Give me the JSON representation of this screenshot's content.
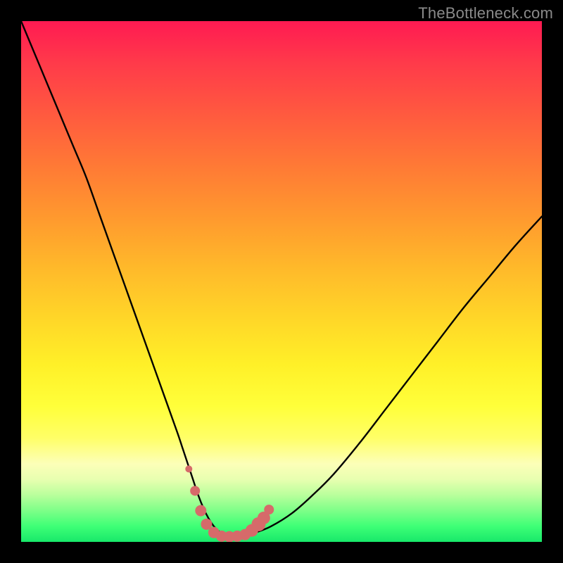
{
  "watermark": {
    "text": "TheBottleneck.com"
  },
  "chart_data": {
    "type": "line",
    "title": "",
    "xlabel": "",
    "ylabel": "",
    "xlim": [
      0,
      100
    ],
    "ylim": [
      0,
      100
    ],
    "series": [
      {
        "name": "bottleneck-curve",
        "x": [
          0,
          2.5,
          5,
          7.5,
          10,
          12.5,
          15,
          17.5,
          20,
          22.5,
          25,
          27.5,
          30,
          31,
          32,
          33,
          34,
          35,
          36,
          37,
          38,
          39,
          40,
          41,
          43,
          45,
          48,
          52,
          56,
          60,
          65,
          70,
          75,
          80,
          85,
          90,
          95,
          100
        ],
        "y": [
          100,
          94,
          88,
          82,
          76,
          70,
          63,
          56,
          49,
          42,
          35,
          28,
          21,
          18,
          15,
          12,
          9,
          6.5,
          4.5,
          3,
          2,
          1.3,
          1,
          1,
          1.2,
          1.8,
          3,
          5.5,
          9,
          13,
          19,
          25.5,
          32,
          38.5,
          45,
          51,
          57,
          62.5
        ]
      }
    ],
    "beads": {
      "name": "marker-beads",
      "color": "#d66a6a",
      "points": [
        {
          "x": 32.2,
          "y": 14.0,
          "r": 5
        },
        {
          "x": 33.4,
          "y": 9.8,
          "r": 7
        },
        {
          "x": 34.5,
          "y": 6.0,
          "r": 8
        },
        {
          "x": 35.6,
          "y": 3.4,
          "r": 8
        },
        {
          "x": 37.0,
          "y": 1.8,
          "r": 8
        },
        {
          "x": 38.5,
          "y": 1.1,
          "r": 8
        },
        {
          "x": 40.0,
          "y": 1.0,
          "r": 8
        },
        {
          "x": 41.5,
          "y": 1.1,
          "r": 8
        },
        {
          "x": 43.0,
          "y": 1.4,
          "r": 8
        },
        {
          "x": 44.3,
          "y": 2.2,
          "r": 9
        },
        {
          "x": 45.6,
          "y": 3.4,
          "r": 10
        },
        {
          "x": 46.6,
          "y": 4.6,
          "r": 9
        },
        {
          "x": 47.6,
          "y": 6.2,
          "r": 7
        }
      ]
    },
    "gradient_stops": [
      {
        "pos": 0,
        "color": "#ff1a52"
      },
      {
        "pos": 18,
        "color": "#ff5a3f"
      },
      {
        "pos": 38,
        "color": "#ff9a2e"
      },
      {
        "pos": 58,
        "color": "#ffd928"
      },
      {
        "pos": 74,
        "color": "#ffff3a"
      },
      {
        "pos": 88,
        "color": "#e8ffb0"
      },
      {
        "pos": 100,
        "color": "#18e86a"
      }
    ]
  }
}
